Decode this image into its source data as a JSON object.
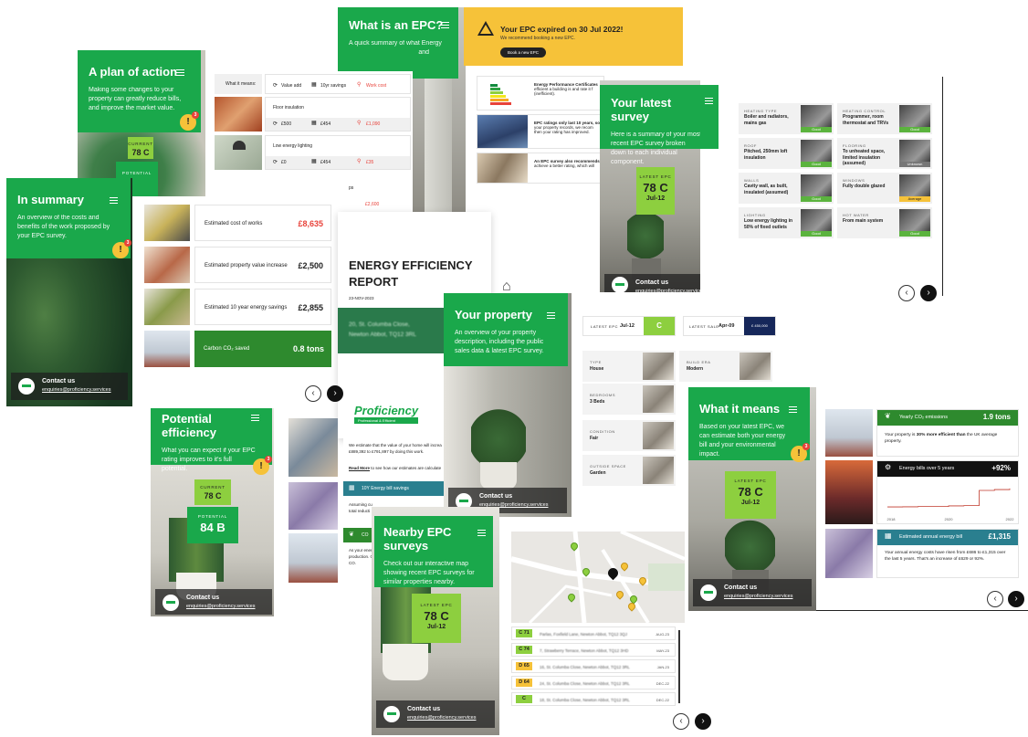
{
  "colors": {
    "brand_green": "#1aa84b",
    "epc_green": "#8dcf3f",
    "warning_yellow": "#f6c239",
    "teal": "#2a7f8f",
    "dark_green": "#2e8a2e"
  },
  "plan": {
    "title": "A plan of action",
    "desc": "Making some changes to your property can greatly reduce bills, and improve the market value.",
    "current_label": "CURRENT",
    "current_value": "78 C",
    "potential_label": "POTENTIAL",
    "badge_count": "3"
  },
  "measures": {
    "header_label": "What it means:",
    "legend_value": "Value add",
    "legend_savings": "10yr savings",
    "legend_cost": "Work cost",
    "items": [
      {
        "name": "Floor insulation",
        "value": "£500",
        "savings": "£454",
        "cost": "£1,090"
      },
      {
        "name": "Low energy lighting",
        "value": "£0",
        "savings": "£454",
        "cost": "£35"
      }
    ],
    "partial_cost": "£2,600",
    "partial_label": "ps"
  },
  "what_is_epc": {
    "title": "What is an EPC?",
    "desc": "A quick summary of what Energy",
    "desc2": "and",
    "item1": "Energy Performance Certificates",
    "item1b": "efficient a building is and rate it f",
    "item1c": "(inefficient).",
    "item2": "EPC ratings only last 10 years, so",
    "item2b": "your property records, we recom",
    "item2c": "then your rating has improved.",
    "item3": "An EPC survey also recommends",
    "item3b": "achieve a better rating, which will"
  },
  "expired": {
    "title": "Your EPC expired on 30 Jul 2022!",
    "sub": "We recommend booking a new EPC.",
    "button": "Book a new EPC"
  },
  "summary": {
    "title": "In summary",
    "desc": "An overview of the costs and benefits of the work proposed by your EPC survey.",
    "badge_count": "3",
    "rows": [
      {
        "label": "Estimated cost of works",
        "value": "£8,635"
      },
      {
        "label": "Estimated property value increase",
        "value": "£2,500"
      },
      {
        "label": "Estimated 10 year energy savings",
        "value": "£2,855"
      }
    ],
    "co2_label": "Carbon CO₂ saved",
    "co2_value": "0.8 tons"
  },
  "contact": {
    "title": "Contact us",
    "email": "enquiries@proficiency.services"
  },
  "report": {
    "title_line1": "ENERGY EFFICIENCY",
    "title_line2": "REPORT",
    "date": "23-NOV-2023",
    "address_line1": "20, St. Columba Close,",
    "address_line2": "Newton Abbot, TQ12 3RL",
    "brand": "Proficiency",
    "brand_sub": "Professional & Efficient",
    "estimate_text": "We estimate that the value of your home will increa",
    "estimate_text2": "£889,392 to £791,897 by doing this work.",
    "read_more": "Read More",
    "read_more_rest": "to see how our estimates are calculate",
    "bill_savings": "10Y Energy bill savings",
    "assume1": "Assuming cu",
    "assume2": "total reducti",
    "co2_short": "CO",
    "as_your": "As your ener",
    "production": "production. C",
    "co2_end": "CO."
  },
  "survey": {
    "title": "Your latest survey",
    "desc": "Here is a summary of your most recent EPC survey broken down to each individual component.",
    "epc_label": "LATEST EPC",
    "epc_value": "78 C",
    "epc_date": "Jul-12",
    "components": [
      {
        "label": "HEATING TYPE",
        "value": "Boiler and radiators, mains gas",
        "rating": "Good"
      },
      {
        "label": "HEATING CONTROL",
        "value": "Programmer, room thermostat and TRVs",
        "rating": "Good"
      },
      {
        "label": "ROOF",
        "value": "Pitched, 250mm loft insulation",
        "rating": "Good"
      },
      {
        "label": "FLOORING",
        "value": "To unheated space, limited insulation (assumed)",
        "rating": "Unknown"
      },
      {
        "label": "WALLS",
        "value": "Cavity wall, as built, insulated (assumed)",
        "rating": "Good"
      },
      {
        "label": "WINDOWS",
        "value": "Fully double glazed",
        "rating": "Average"
      },
      {
        "label": "LIGHTING",
        "value": "Low energy lighting in 50% of fixed outlets",
        "rating": "Good"
      },
      {
        "label": "HOT WATER",
        "value": "From main system",
        "rating": "Good"
      }
    ]
  },
  "property": {
    "title": "Your property",
    "desc": "An overview of your property description, including the public sales data & latest EPC survey.",
    "latest_epc_label": "LATEST EPC",
    "latest_epc_date": "Jul-12",
    "latest_epc_rating": "C",
    "latest_sale_label": "LATEST SALE",
    "latest_sale_date": "Apr-09",
    "latest_sale_value": "£ 450,000",
    "attributes": [
      {
        "label": "TYPE",
        "value": "House"
      },
      {
        "label": "BUILD ERA",
        "value": "Modern"
      },
      {
        "label": "BEDROOMS",
        "value": "3 Beds"
      },
      {
        "label": "CONDITION",
        "value": "Fair"
      },
      {
        "label": "OUTSIDE SPACE",
        "value": "Garden"
      }
    ]
  },
  "potential": {
    "title": "Potential efficiency",
    "desc": "What you can expect if your EPC rating improves to it's full potential.",
    "current_label": "CURRENT",
    "current_value": "78 C",
    "potential_label": "POTENTIAL",
    "potential_value": "84 B",
    "badge_count": "3"
  },
  "nearby": {
    "title": "Nearby EPC surveys",
    "desc": "Check out our interactive map showing recent EPC surveys for similar properties nearby.",
    "epc_label": "LATEST EPC",
    "epc_value": "78 C",
    "epc_date": "Jul-12",
    "list": [
      {
        "rating": "C 71",
        "address": "Parlas, Foxfield Lane, Newton Abbot, TQ12 3QJ",
        "date": "AUG-23"
      },
      {
        "rating": "C 74",
        "address": "7, Strawberry Terrace, Newton Abbot, TQ12 3HD",
        "date": "MAY-23"
      },
      {
        "rating": "D 65",
        "address": "16, St. Columba Close, Newton Abbot, TQ12 3RL",
        "date": "JAN-23"
      },
      {
        "rating": "D 64",
        "address": "24, St. Columba Close, Newton Abbot, TQ12 3RL",
        "date": "DEC-22"
      },
      {
        "rating": "C",
        "address": "18, St. Columba Close, Newton Abbot, TQ12 3RL",
        "date": "DEC-22"
      }
    ]
  },
  "means": {
    "title": "What it means",
    "desc": "Based on your latest EPC, we can estimate both your energy bill and your environmental impact.",
    "epc_label": "LATEST EPC",
    "epc_value": "78 C",
    "epc_date": "Jul-12",
    "badge_count": "3",
    "co2_title": "Yearly CO₂ emissions",
    "co2_value": "1.9 tons",
    "co2_text_a": "Your property is ",
    "co2_text_b": "30% more efficient than",
    "co2_text_c": " the UK average property.",
    "bills_title": "Energy bills over 5 years",
    "bills_value": "+92%",
    "annual_title": "Estimated annual energy bill",
    "annual_value": "£1,315",
    "annual_text": "Your annual energy costs have risen from £686 to £1,315 over the last 5 years. That's an increase of £629 or 92%."
  },
  "chart_data": {
    "type": "line",
    "x": [
      "2019",
      "2020",
      "2020.5",
      "2021",
      "2021.5",
      "2022",
      "2022.5",
      "2023",
      "2023.5"
    ],
    "series": [
      {
        "values": [
          686,
          690,
          700,
          700,
          720,
          730,
          1250,
          1280,
          1315
        ]
      }
    ],
    "tick_labels": [
      "2018",
      "2020",
      "2022"
    ],
    "ylim": [
      500,
      1500
    ],
    "grid": false
  },
  "nav": {
    "prev": "‹",
    "next": "›"
  }
}
